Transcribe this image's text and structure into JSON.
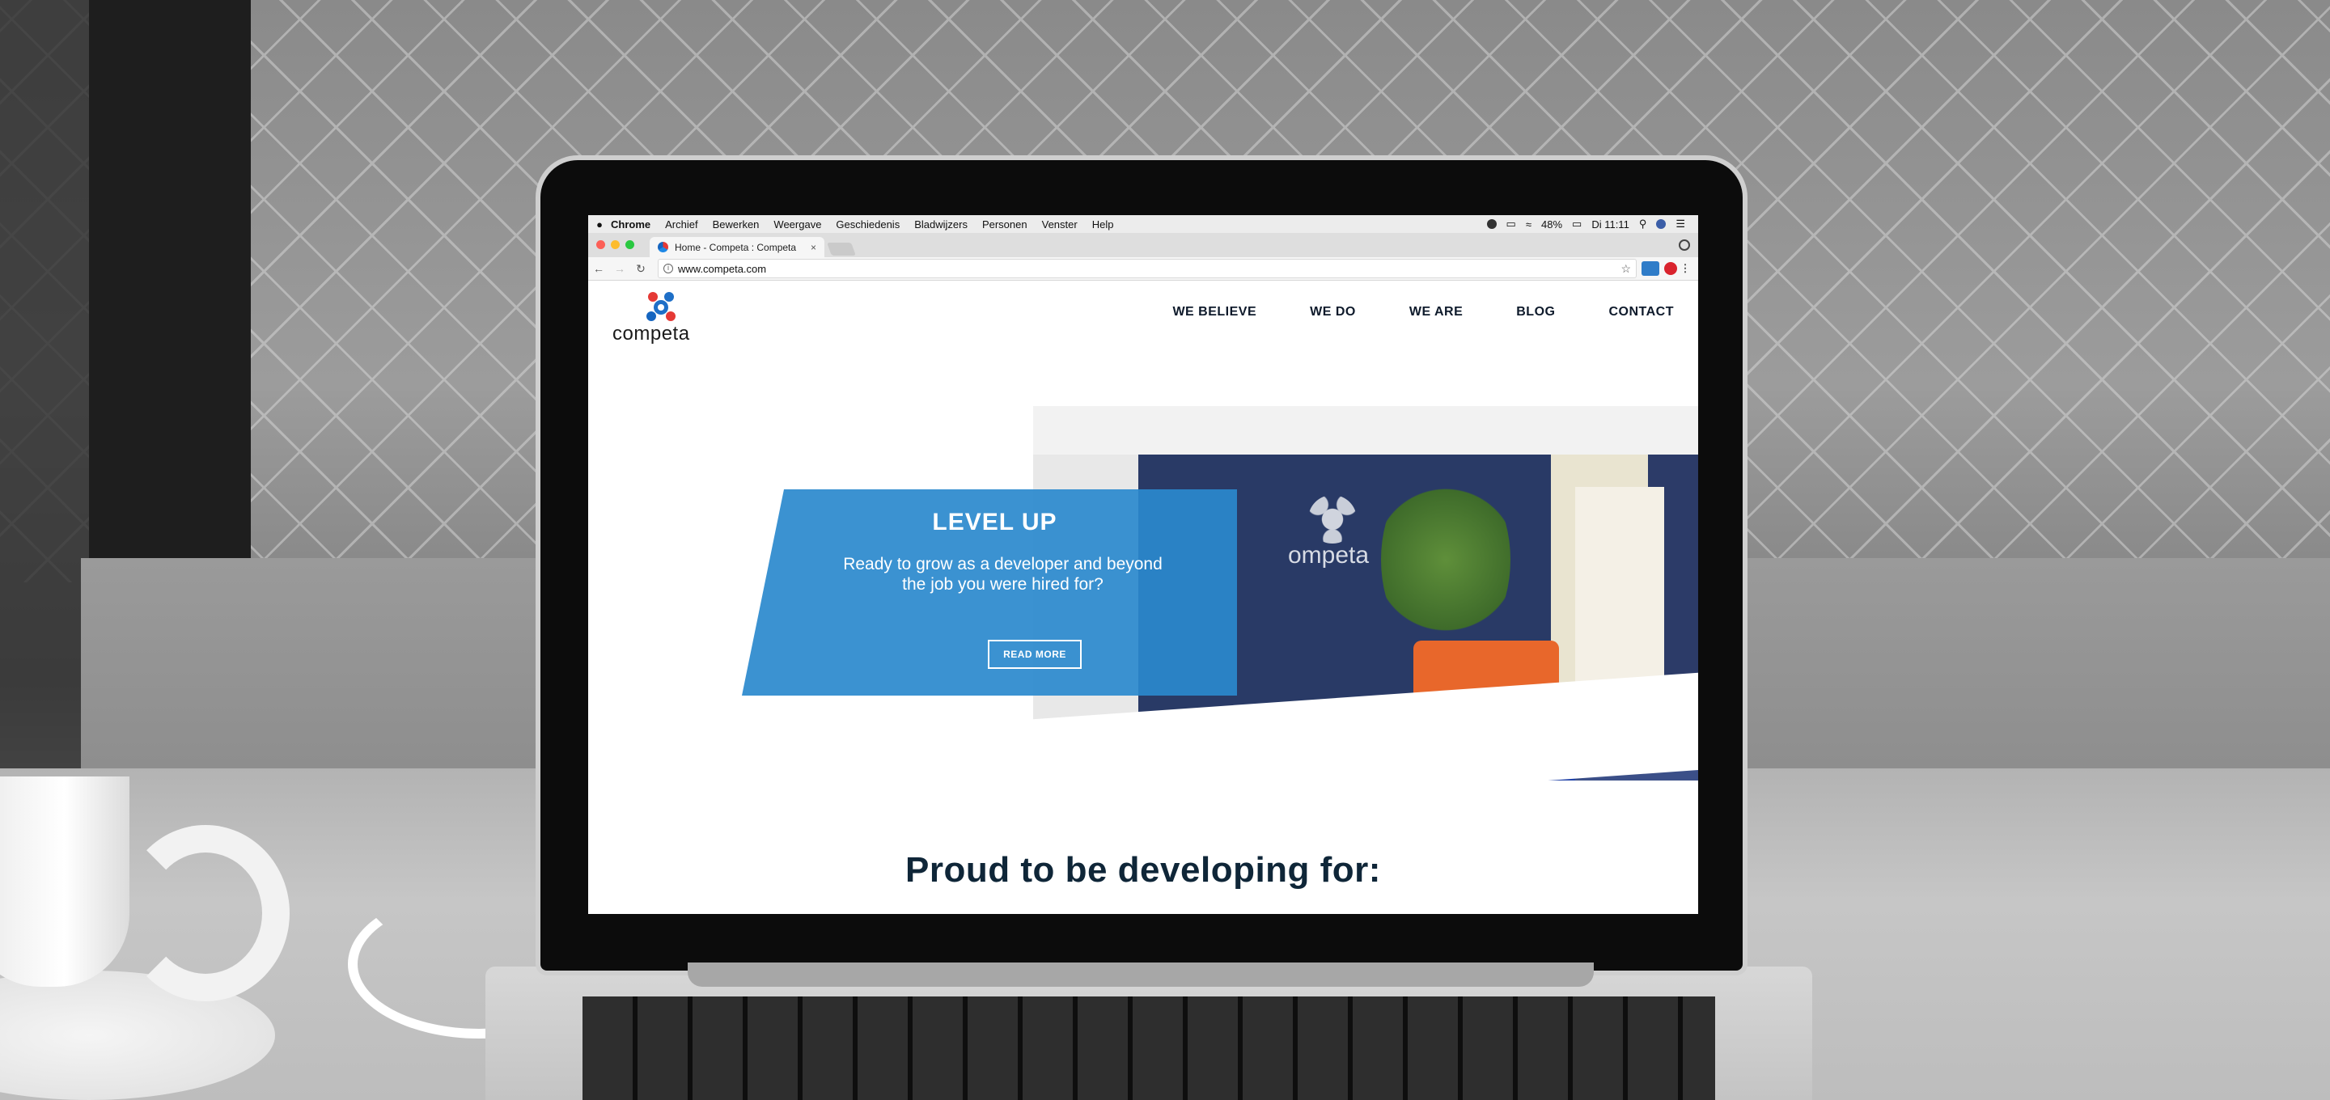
{
  "menubar": {
    "app": "Chrome",
    "items": [
      "Archief",
      "Bewerken",
      "Weergave",
      "Geschiedenis",
      "Bladwijzers",
      "Personen",
      "Venster",
      "Help"
    ],
    "battery": "48%",
    "clock": "Di 11:11"
  },
  "browser": {
    "tab_title": "Home - Competa : Competa",
    "tab_close": "×",
    "url": "www.competa.com"
  },
  "site": {
    "logo_text": "competa",
    "nav": [
      "WE BELIEVE",
      "WE DO",
      "WE ARE",
      "BLOG",
      "CONTACT"
    ],
    "photo_watermark": "ompeta",
    "hero": {
      "title": "LEVEL UP",
      "text": "Ready to grow as a developer and beyond the job you were hired for?",
      "button": "READ MORE"
    },
    "section_heading": "Proud to be developing for:"
  },
  "colors": {
    "hero_blue": "#2a89cd",
    "heading_navy": "#0f2638",
    "logo_red": "#e53935",
    "logo_blue": "#1e6fc7"
  }
}
